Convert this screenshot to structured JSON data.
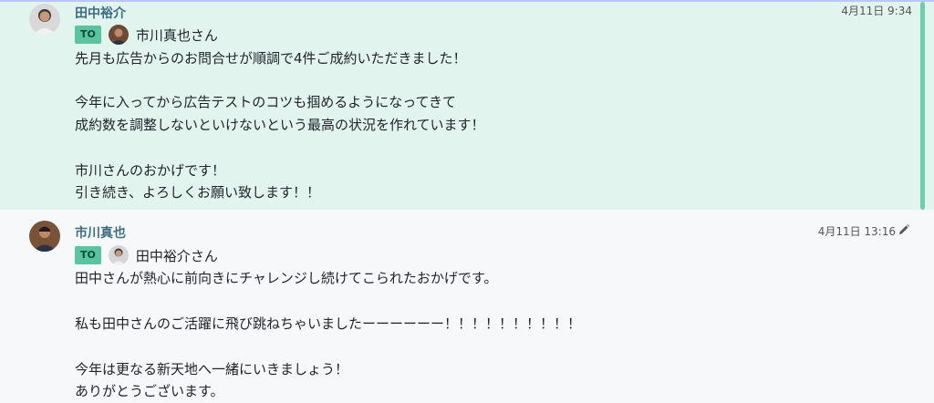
{
  "messages": [
    {
      "sender": "田中裕介",
      "timestamp": "4月11日 9:34",
      "to_badge": "TO",
      "to_name": "市川真也さん",
      "lines": [
        "先月も広告からのお問合せが順調で4件ご成約いただきました！",
        "",
        "今年に入ってから広告テストのコツも掴めるようになってきて",
        "成約数を調整しないといけないという最高の状況を作れています！",
        "",
        "市川さんのおかげです！",
        "引き続き、よろしくお願い致します！！"
      ],
      "highlight_color": "#e1f4ee",
      "bar_color": "#6ccfae"
    },
    {
      "sender": "市川真也",
      "timestamp": "4月11日 13:16",
      "to_badge": "TO",
      "to_name": "田中裕介さん",
      "lines": [
        "田中さんが熱心に前向きにチャレンジし続けてこられたおかげです。",
        "",
        "私も田中さんのご活躍に飛び跳ねちゃいましたーーーーーー！！！！！！！！！！",
        "",
        "今年は更なる新天地へ一緒にいきましょう！",
        "ありがとうございます。"
      ],
      "edit_icon": "pencil-icon"
    }
  ],
  "colors": {
    "sender_name": "#3b6e84",
    "to_badge_bg": "#59c4a0"
  }
}
